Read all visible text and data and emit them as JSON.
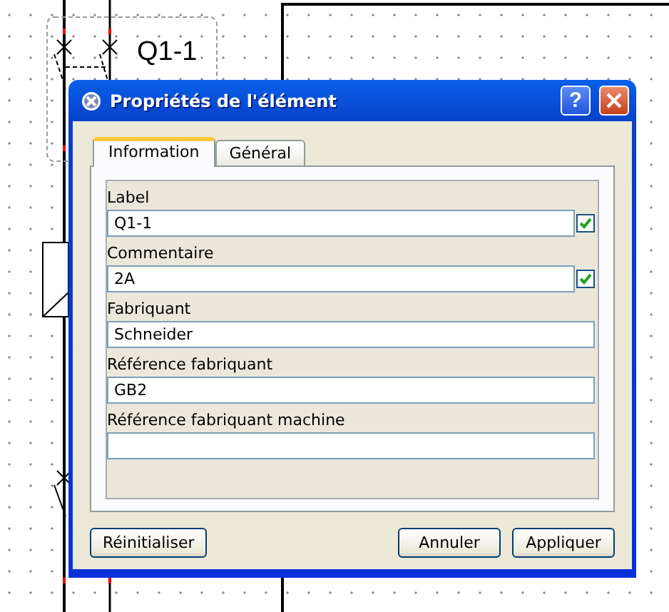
{
  "canvas": {
    "component_label": "Q1-1"
  },
  "dialog": {
    "title": "Propriétés de l'élément",
    "help_button": "?",
    "tabs": [
      {
        "label": "Information",
        "selected": true
      },
      {
        "label": "Général",
        "selected": false
      }
    ],
    "fields": [
      {
        "label": "Label",
        "value": "Q1-1",
        "kind": "checkable",
        "checked": true
      },
      {
        "label": "Commentaire",
        "value": "2A",
        "kind": "checkable",
        "checked": true
      },
      {
        "label": "Fabriquant",
        "value": "Schneider",
        "kind": "plain"
      },
      {
        "label": "Référence fabriquant",
        "value": "GB2",
        "kind": "plain"
      },
      {
        "label": "Référence fabriquant machine",
        "kind": "plain"
      }
    ],
    "buttons": [
      {
        "label": "Réinitialiser",
        "kind": "reset"
      },
      {
        "label": "Annuler",
        "kind": "action"
      },
      {
        "label": "Appliquer",
        "kind": "action"
      }
    ]
  }
}
